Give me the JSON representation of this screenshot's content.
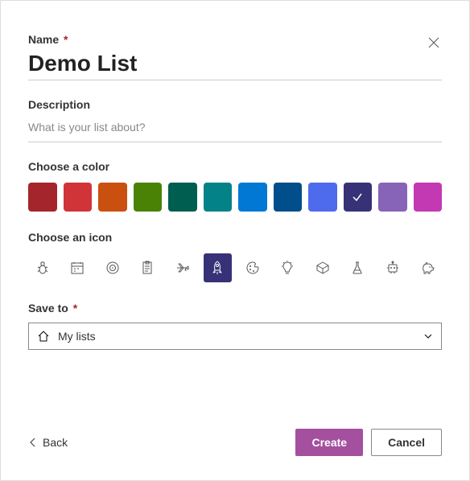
{
  "labels": {
    "name": "Name",
    "description": "Description",
    "choose_color": "Choose a color",
    "choose_icon": "Choose an icon",
    "save_to": "Save to",
    "required_marker": "*"
  },
  "fields": {
    "name_value": "Demo List",
    "description_value": "",
    "description_placeholder": "What is your list about?",
    "save_to_value": "My lists"
  },
  "colors": [
    {
      "name": "dark-red",
      "hex": "#a4262c",
      "selected": false
    },
    {
      "name": "red",
      "hex": "#d13438",
      "selected": false
    },
    {
      "name": "orange",
      "hex": "#ca5010",
      "selected": false
    },
    {
      "name": "green",
      "hex": "#498205",
      "selected": false
    },
    {
      "name": "dark-teal",
      "hex": "#005e50",
      "selected": false
    },
    {
      "name": "teal",
      "hex": "#038387",
      "selected": false
    },
    {
      "name": "blue",
      "hex": "#0078d4",
      "selected": false
    },
    {
      "name": "dark-blue",
      "hex": "#004e8c",
      "selected": false
    },
    {
      "name": "periwinkle",
      "hex": "#4f6bed",
      "selected": false
    },
    {
      "name": "dark-purple",
      "hex": "#373277",
      "selected": true
    },
    {
      "name": "purple",
      "hex": "#8764b8",
      "selected": false
    },
    {
      "name": "pink",
      "hex": "#c239b3",
      "selected": false
    }
  ],
  "icons": [
    {
      "name": "bug",
      "selected": false
    },
    {
      "name": "calendar",
      "selected": false
    },
    {
      "name": "target",
      "selected": false
    },
    {
      "name": "clipboard",
      "selected": false
    },
    {
      "name": "airplane",
      "selected": false
    },
    {
      "name": "rocket",
      "selected": true
    },
    {
      "name": "palette",
      "selected": false
    },
    {
      "name": "lightbulb",
      "selected": false
    },
    {
      "name": "cube",
      "selected": false
    },
    {
      "name": "flask",
      "selected": false
    },
    {
      "name": "robot",
      "selected": false
    },
    {
      "name": "piggy-bank",
      "selected": false
    }
  ],
  "selected_color_hex": "#373277",
  "buttons": {
    "back": "Back",
    "create": "Create",
    "cancel": "Cancel"
  }
}
